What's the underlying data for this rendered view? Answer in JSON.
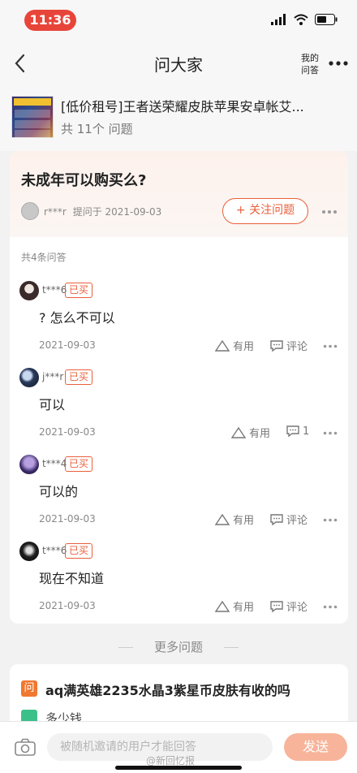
{
  "status_bar": {
    "time": "11:36"
  },
  "nav": {
    "title": "问大家",
    "my_qa_line1": "我的",
    "my_qa_line2": "问答"
  },
  "product": {
    "name": "[低价租号]王者送荣耀皮肤苹果安卓帐艾...",
    "question_count": "共 11个 问题"
  },
  "question": {
    "title": "未成年可以购买么?",
    "asker": "r***r",
    "asked_on": "提问于 2021-09-03",
    "follow_label": "+ 关注问题"
  },
  "answers": {
    "total": "共4条问答",
    "items": [
      {
        "user": "t***6",
        "tag": "已买",
        "text": "? 怎么不可以",
        "date": "2021-09-03",
        "useful": "有用",
        "comment": "评论"
      },
      {
        "user": "j***r",
        "tag": "已买",
        "text": "可以",
        "date": "2021-09-03",
        "useful": "有用",
        "comment": "1"
      },
      {
        "user": "t***4",
        "tag": "已买",
        "text": "可以的",
        "date": "2021-09-03",
        "useful": "有用",
        "comment": "评论"
      },
      {
        "user": "t***6",
        "tag": "已买",
        "text": "现在不知道",
        "date": "2021-09-03",
        "useful": "有用",
        "comment": "评论"
      }
    ]
  },
  "more_questions": {
    "header": "更多问题",
    "item_icon": "问",
    "item_title": "aq满英雄2235水晶3紫星币皮肤有收的吗",
    "item_answer": "多少钱"
  },
  "bottom_bar": {
    "placeholder": "被随机邀请的用户才能回答",
    "send_label": "发送"
  },
  "watermark": "@新回忆报",
  "colors": {
    "accent": "#e8603c",
    "status_pill": "#e8453a",
    "send_disabled": "#f7b49a"
  }
}
